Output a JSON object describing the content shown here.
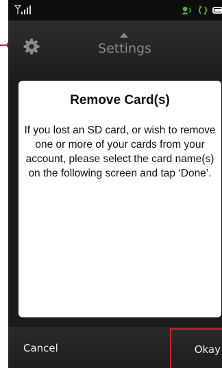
{
  "status_bar": {
    "icons": [
      "signal-icon",
      "headset-icon",
      "sync-icon",
      "battery-icon"
    ],
    "colors": {
      "green": "#3fbf2a",
      "white": "#ffffff"
    }
  },
  "title_bar": {
    "title": "Settings",
    "icons": [
      "gear-icon",
      "caret-up-icon"
    ]
  },
  "dialog": {
    "heading": "Remove Card(s)",
    "message": "If you lost an SD card, or wish to remove one or more of your cards from your account, please select the card name(s) on the following screen and tap ‘Done’."
  },
  "bottom_bar": {
    "cancel_label": "Cancel",
    "okay_label": "Okay",
    "highlight_color": "#d0202c"
  },
  "annotation": {
    "arrow_color": "#d0202c"
  }
}
